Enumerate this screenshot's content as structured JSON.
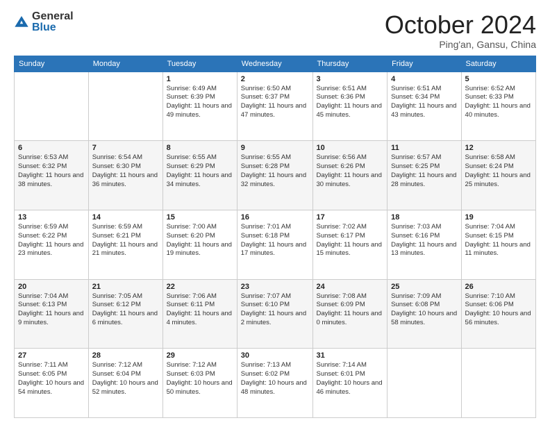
{
  "logo": {
    "general": "General",
    "blue": "Blue"
  },
  "title": "October 2024",
  "location": "Ping'an, Gansu, China",
  "days_of_week": [
    "Sunday",
    "Monday",
    "Tuesday",
    "Wednesday",
    "Thursday",
    "Friday",
    "Saturday"
  ],
  "weeks": [
    [
      {
        "day": "",
        "info": ""
      },
      {
        "day": "",
        "info": ""
      },
      {
        "day": "1",
        "info": "Sunrise: 6:49 AM\nSunset: 6:39 PM\nDaylight: 11 hours and 49 minutes."
      },
      {
        "day": "2",
        "info": "Sunrise: 6:50 AM\nSunset: 6:37 PM\nDaylight: 11 hours and 47 minutes."
      },
      {
        "day": "3",
        "info": "Sunrise: 6:51 AM\nSunset: 6:36 PM\nDaylight: 11 hours and 45 minutes."
      },
      {
        "day": "4",
        "info": "Sunrise: 6:51 AM\nSunset: 6:34 PM\nDaylight: 11 hours and 43 minutes."
      },
      {
        "day": "5",
        "info": "Sunrise: 6:52 AM\nSunset: 6:33 PM\nDaylight: 11 hours and 40 minutes."
      }
    ],
    [
      {
        "day": "6",
        "info": "Sunrise: 6:53 AM\nSunset: 6:32 PM\nDaylight: 11 hours and 38 minutes."
      },
      {
        "day": "7",
        "info": "Sunrise: 6:54 AM\nSunset: 6:30 PM\nDaylight: 11 hours and 36 minutes."
      },
      {
        "day": "8",
        "info": "Sunrise: 6:55 AM\nSunset: 6:29 PM\nDaylight: 11 hours and 34 minutes."
      },
      {
        "day": "9",
        "info": "Sunrise: 6:55 AM\nSunset: 6:28 PM\nDaylight: 11 hours and 32 minutes."
      },
      {
        "day": "10",
        "info": "Sunrise: 6:56 AM\nSunset: 6:26 PM\nDaylight: 11 hours and 30 minutes."
      },
      {
        "day": "11",
        "info": "Sunrise: 6:57 AM\nSunset: 6:25 PM\nDaylight: 11 hours and 28 minutes."
      },
      {
        "day": "12",
        "info": "Sunrise: 6:58 AM\nSunset: 6:24 PM\nDaylight: 11 hours and 25 minutes."
      }
    ],
    [
      {
        "day": "13",
        "info": "Sunrise: 6:59 AM\nSunset: 6:22 PM\nDaylight: 11 hours and 23 minutes."
      },
      {
        "day": "14",
        "info": "Sunrise: 6:59 AM\nSunset: 6:21 PM\nDaylight: 11 hours and 21 minutes."
      },
      {
        "day": "15",
        "info": "Sunrise: 7:00 AM\nSunset: 6:20 PM\nDaylight: 11 hours and 19 minutes."
      },
      {
        "day": "16",
        "info": "Sunrise: 7:01 AM\nSunset: 6:18 PM\nDaylight: 11 hours and 17 minutes."
      },
      {
        "day": "17",
        "info": "Sunrise: 7:02 AM\nSunset: 6:17 PM\nDaylight: 11 hours and 15 minutes."
      },
      {
        "day": "18",
        "info": "Sunrise: 7:03 AM\nSunset: 6:16 PM\nDaylight: 11 hours and 13 minutes."
      },
      {
        "day": "19",
        "info": "Sunrise: 7:04 AM\nSunset: 6:15 PM\nDaylight: 11 hours and 11 minutes."
      }
    ],
    [
      {
        "day": "20",
        "info": "Sunrise: 7:04 AM\nSunset: 6:13 PM\nDaylight: 11 hours and 9 minutes."
      },
      {
        "day": "21",
        "info": "Sunrise: 7:05 AM\nSunset: 6:12 PM\nDaylight: 11 hours and 6 minutes."
      },
      {
        "day": "22",
        "info": "Sunrise: 7:06 AM\nSunset: 6:11 PM\nDaylight: 11 hours and 4 minutes."
      },
      {
        "day": "23",
        "info": "Sunrise: 7:07 AM\nSunset: 6:10 PM\nDaylight: 11 hours and 2 minutes."
      },
      {
        "day": "24",
        "info": "Sunrise: 7:08 AM\nSunset: 6:09 PM\nDaylight: 11 hours and 0 minutes."
      },
      {
        "day": "25",
        "info": "Sunrise: 7:09 AM\nSunset: 6:08 PM\nDaylight: 10 hours and 58 minutes."
      },
      {
        "day": "26",
        "info": "Sunrise: 7:10 AM\nSunset: 6:06 PM\nDaylight: 10 hours and 56 minutes."
      }
    ],
    [
      {
        "day": "27",
        "info": "Sunrise: 7:11 AM\nSunset: 6:05 PM\nDaylight: 10 hours and 54 minutes."
      },
      {
        "day": "28",
        "info": "Sunrise: 7:12 AM\nSunset: 6:04 PM\nDaylight: 10 hours and 52 minutes."
      },
      {
        "day": "29",
        "info": "Sunrise: 7:12 AM\nSunset: 6:03 PM\nDaylight: 10 hours and 50 minutes."
      },
      {
        "day": "30",
        "info": "Sunrise: 7:13 AM\nSunset: 6:02 PM\nDaylight: 10 hours and 48 minutes."
      },
      {
        "day": "31",
        "info": "Sunrise: 7:14 AM\nSunset: 6:01 PM\nDaylight: 10 hours and 46 minutes."
      },
      {
        "day": "",
        "info": ""
      },
      {
        "day": "",
        "info": ""
      }
    ]
  ]
}
